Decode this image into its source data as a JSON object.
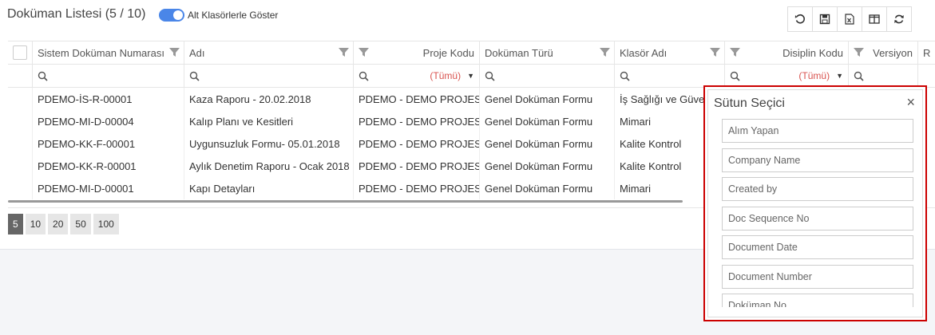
{
  "header": {
    "title": "Doküman Listesi (5 / 10)",
    "toggle_label": "Alt Klasörlerle Göster"
  },
  "toolbar": {
    "buttons": [
      "undo-icon",
      "save-icon",
      "excel-export-icon",
      "columns-icon",
      "refresh-icon"
    ]
  },
  "grid": {
    "columns": [
      "Sistem Doküman Numarası",
      "Adı",
      "Proje Kodu",
      "Doküman Türü",
      "Klasör Adı",
      "Disiplin Kodu",
      "Versiyon",
      "R"
    ],
    "filters": {
      "proje_kodu": "(Tümü)",
      "disiplin_kodu": "(Tümü)"
    },
    "rows": [
      [
        "PDEMO-İS-R-00001",
        "Kaza Raporu - 20.02.2018",
        "PDEMO - DEMO PROJESİ",
        "Genel Doküman Formu",
        "İş Sağlığı ve Güvenliği"
      ],
      [
        "PDEMO-MI-D-00004",
        "Kalıp Planı ve Kesitleri",
        "PDEMO - DEMO PROJESİ",
        "Genel Doküman Formu",
        "Mimari"
      ],
      [
        "PDEMO-KK-F-00001",
        "Uygunsuzluk Formu- 05.01.2018",
        "PDEMO - DEMO PROJESİ",
        "Genel Doküman Formu",
        "Kalite Kontrol"
      ],
      [
        "PDEMO-KK-R-00001",
        "Aylık Denetim Raporu - Ocak 2018",
        "PDEMO - DEMO PROJESİ",
        "Genel Doküman Formu",
        "Kalite Kontrol"
      ],
      [
        "PDEMO-MI-D-00001",
        "Kapı Detayları",
        "PDEMO - DEMO PROJESİ",
        "Genel Doküman Formu",
        "Mimari"
      ]
    ]
  },
  "pager": {
    "sizes": [
      "5",
      "10",
      "20",
      "50",
      "100"
    ],
    "active": "5"
  },
  "column_chooser": {
    "title": "Sütun Seçici",
    "close": "×",
    "items": [
      "Alım Yapan",
      "Company Name",
      "Created by",
      "Doc Sequence No",
      "Document Date",
      "Document Number",
      "Doküman No"
    ]
  },
  "colors": {
    "accent": "#4a86e8",
    "filter_text": "#d9534f",
    "highlight_border": "#cc0000"
  }
}
